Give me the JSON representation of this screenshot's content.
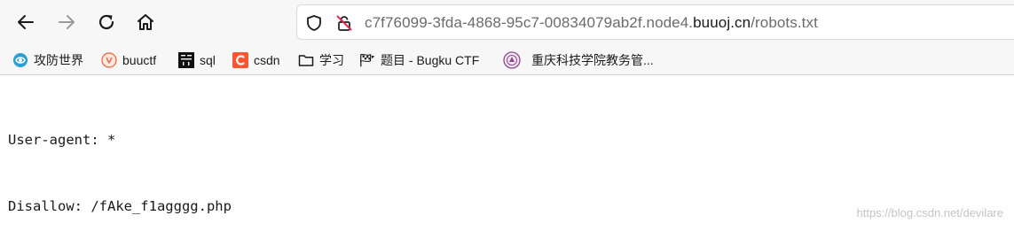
{
  "browser": {
    "nav": {
      "back": "back-arrow-icon",
      "forward": "forward-arrow-icon",
      "reload": "reload-icon",
      "home": "home-icon"
    },
    "url": {
      "prefix": "c7f76099-3fda-4868-95c7-00834079ab2f.node4.",
      "host": "buuoj.cn",
      "path": "/robots.txt"
    }
  },
  "bookmarks": [
    {
      "label": "攻防世界",
      "icon": "adworld-icon"
    },
    {
      "label": "buuctf",
      "icon": "buuctf-icon"
    },
    {
      "label": "sql",
      "icon": "hackit-icon"
    },
    {
      "label": "csdn",
      "icon": "csdn-icon"
    },
    {
      "label": "学习",
      "icon": "folder-icon"
    },
    {
      "label": "题目 - Bugku CTF",
      "icon": "flag-icon"
    },
    {
      "label": "重庆科技学院教务管...",
      "icon": "university-icon"
    }
  ],
  "page": {
    "lines": [
      "User-agent: *",
      "Disallow: /fAke_f1agggg.php"
    ]
  },
  "watermark": "https://blog.csdn.net/devilare",
  "colors": {
    "toolbar_bg": "#f7f7f7",
    "csdn_red": "#fc5531",
    "text": "#1a1a1a"
  }
}
